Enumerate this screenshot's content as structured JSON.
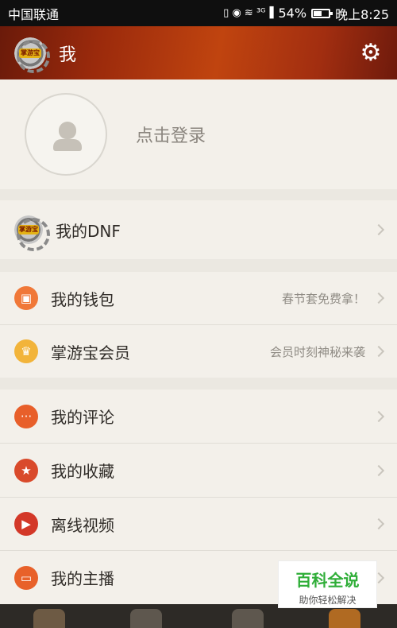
{
  "status_bar": {
    "carrier": "中国联通",
    "icons": "▯ ◉ ≋ ³ᴳ▐",
    "battery": "54%",
    "time": "晚上8:25"
  },
  "header": {
    "logo_text": "掌游宝",
    "title": "我",
    "settings_icon": "⚙"
  },
  "profile": {
    "login_label": "点击登录"
  },
  "menu": {
    "dnf": {
      "label": "我的DNF"
    },
    "wallet": {
      "label": "我的钱包",
      "subtitle": "春节套免费拿！",
      "icon": "▣"
    },
    "vip": {
      "label": "掌游宝会员",
      "subtitle": "会员时刻神秘来袭",
      "icon": "♛"
    },
    "comments": {
      "label": "我的评论",
      "icon": "···"
    },
    "favorites": {
      "label": "我的收藏",
      "icon": "★"
    },
    "offline_video": {
      "label": "离线视频",
      "icon": "▶"
    },
    "anchor": {
      "label": "我的主播",
      "icon": "▭"
    }
  },
  "watermark": {
    "title": "百科全说",
    "subtitle": "助你轻松解决"
  }
}
